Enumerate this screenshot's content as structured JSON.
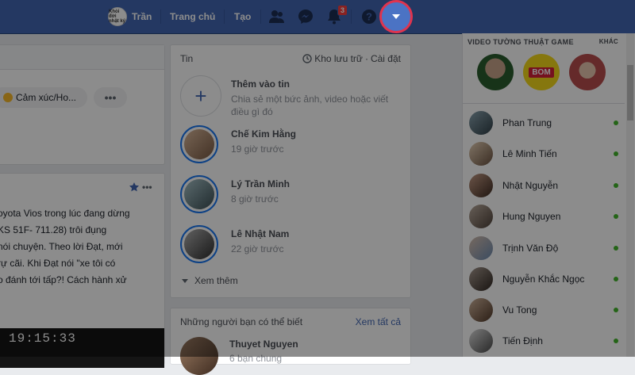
{
  "topbar": {
    "profile_name": "Trần",
    "profile_avatar_text": "Khỏi đời nhật ký",
    "home_label": "Trang chủ",
    "create_label": "Tạo",
    "notification_count": "3"
  },
  "composer": {
    "feeling_label": "Cảm xúc/Ho...",
    "more_label": "•••"
  },
  "post": {
    "text": "oyota Vios trong lúc đang dừng\nKS 51F- 711.28) trôi đụng\nnói chuyện. Theo lời Đạt, mới\nrự cãi. Khi Đạt nói \"xe tôi có\no đánh tới tấp?! Cách hành xử",
    "video_time": "19:15:33",
    "menu_label": "•••"
  },
  "stories": {
    "title": "Tin",
    "archive_label": "Kho lưu trữ",
    "settings_label": "Cài đặt",
    "separator": "·",
    "add_title": "Thêm vào tin",
    "add_sub": "Chia sẻ một bức ảnh, video hoặc viết điều gì đó",
    "items": [
      {
        "name": "Chế Kim Hằng",
        "time": "19 giờ trước"
      },
      {
        "name": "Lý Trần Minh",
        "time": "8 giờ trước"
      },
      {
        "name": "Lê Nhật Nam",
        "time": "22 giờ trước"
      }
    ],
    "see_more": "Xem thêm"
  },
  "pymk": {
    "title": "Những người bạn có thể biết",
    "see_all": "Xem tất cả",
    "person_name": "Thuyet Nguyen",
    "person_sub": "6 bạn chung"
  },
  "game_video": {
    "title": "VIDEO TƯỜNG THUẬT GAME",
    "more_label": "KHÁC",
    "logo_text": "BOM"
  },
  "contacts": [
    {
      "name": "Phan Trung"
    },
    {
      "name": "Lê Minh Tiến"
    },
    {
      "name": "Nhật Nguyễn"
    },
    {
      "name": "Hung Nguyen"
    },
    {
      "name": "Trịnh Văn Độ"
    },
    {
      "name": "Nguyễn Khắc Ngọc"
    },
    {
      "name": "Vu Tong"
    },
    {
      "name": "Tiến Định"
    }
  ],
  "colors": {
    "brand_blue": "#4267b2",
    "highlight_red": "#e0344e",
    "online_green": "#42b72a"
  }
}
